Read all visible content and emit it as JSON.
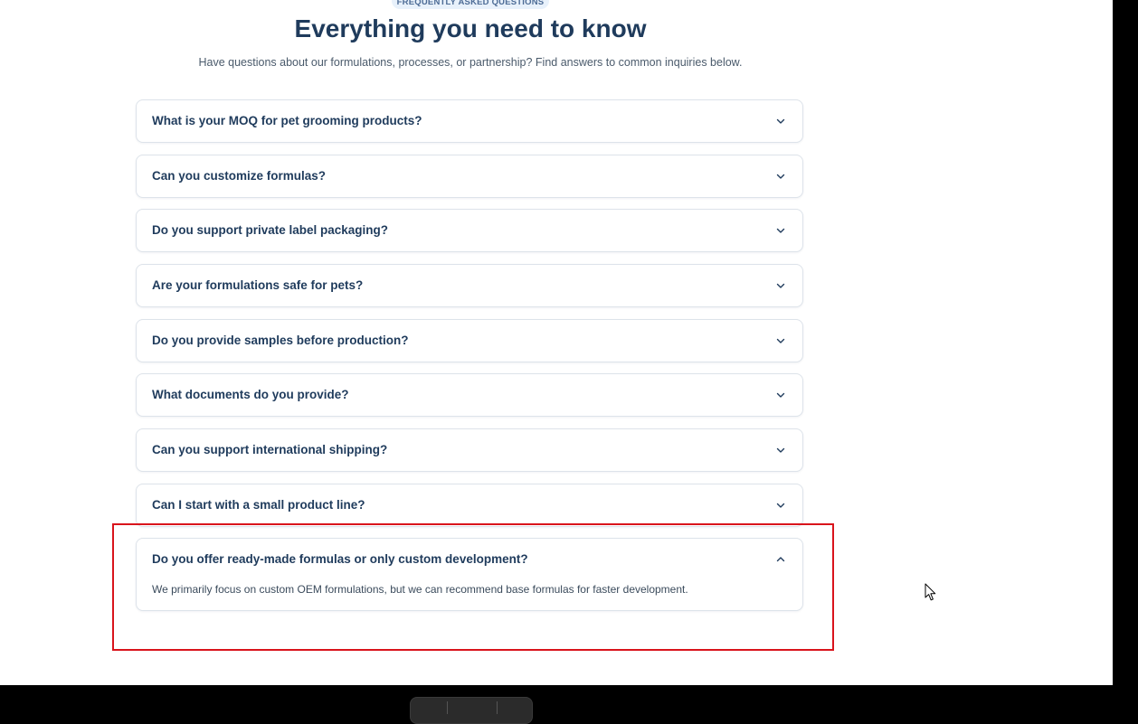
{
  "section": {
    "eyebrow": "FREQUENTLY ASKED QUESTIONS",
    "title": "Everything you need to know",
    "subtitle": "Have questions about our formulations, processes, or partnership? Find answers to common inquiries below."
  },
  "faq": {
    "items": [
      {
        "question": "What is your MOQ for pet grooming products?",
        "expanded": false,
        "icon": "chevron-down-icon"
      },
      {
        "question": "Can you customize formulas?",
        "expanded": false,
        "icon": "chevron-down-icon"
      },
      {
        "question": "Do you support private label packaging?",
        "expanded": false,
        "icon": "chevron-down-icon"
      },
      {
        "question": "Are your formulations safe for pets?",
        "expanded": false,
        "icon": "chevron-down-icon"
      },
      {
        "question": "Do you provide samples before production?",
        "expanded": false,
        "icon": "chevron-down-icon"
      },
      {
        "question": "What documents do you provide?",
        "expanded": false,
        "icon": "chevron-down-icon"
      },
      {
        "question": "Can you support international shipping?",
        "expanded": false,
        "icon": "chevron-down-icon"
      },
      {
        "question": "Can I start with a small product line?",
        "expanded": false,
        "icon": "chevron-down-icon"
      },
      {
        "question": "Do you offer ready-made formulas or only custom development?",
        "expanded": true,
        "icon": "chevron-up-icon",
        "answer": "We primarily focus on custom OEM formulations, but we can recommend base formulas for faster development."
      }
    ]
  },
  "colors": {
    "heading": "#1f3b5c",
    "body_text": "#3b4b5c",
    "card_border": "#dde3ea",
    "eyebrow_bg": "#e8f1fb",
    "highlight": "#d9141c",
    "page_bg": "#ffffff",
    "outer_bg": "#000000"
  }
}
